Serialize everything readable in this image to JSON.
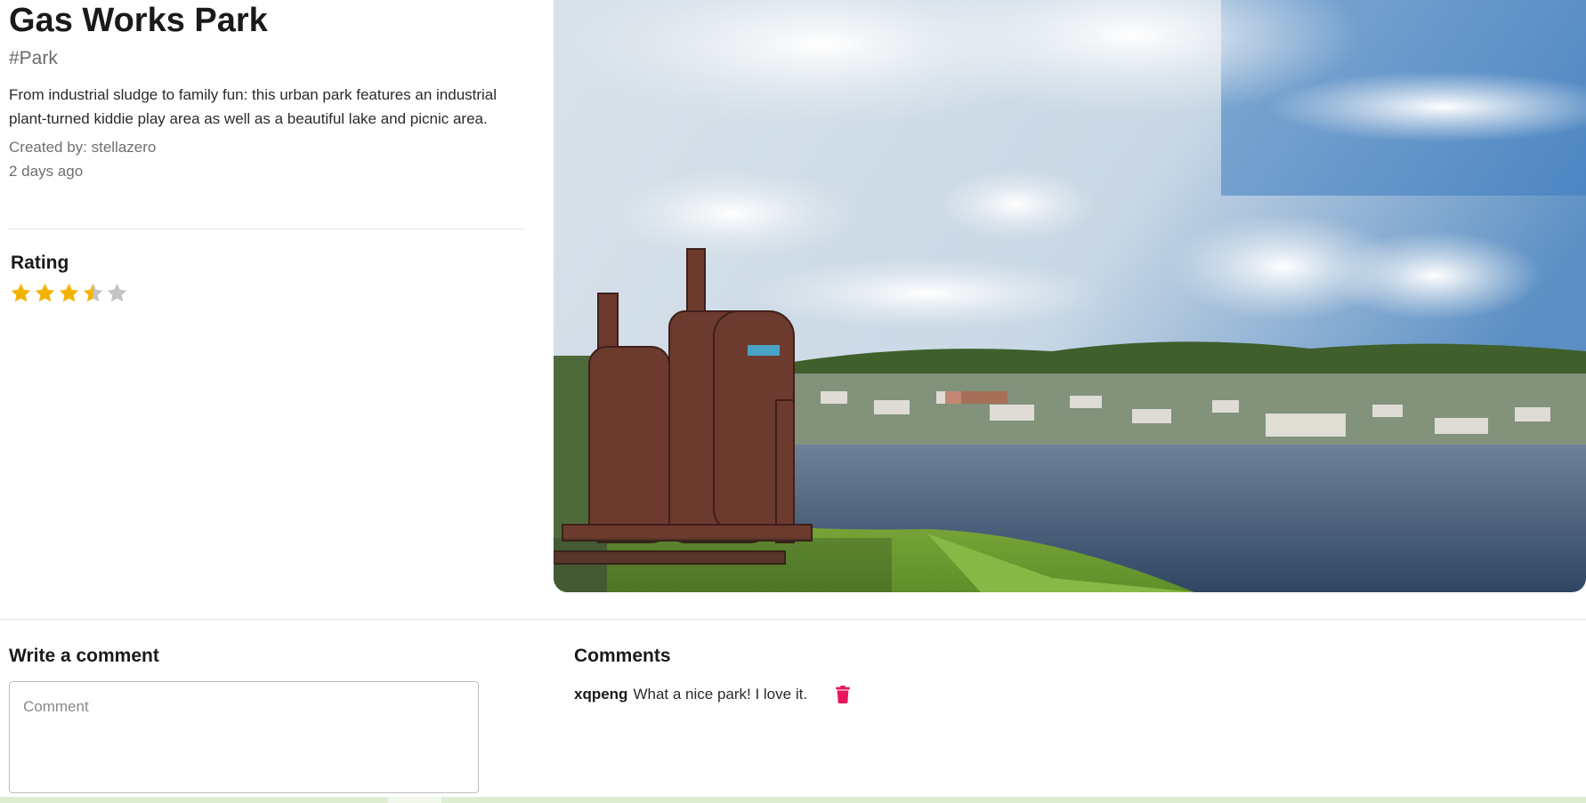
{
  "place": {
    "title": "Gas Works Park",
    "tag": "#Park",
    "description": "From industrial sludge to family fun: this urban park features an industrial plant-turned kiddie play area as well as a beautiful lake and picnic area.",
    "created_by": "Created by: stellazero",
    "time_ago": "2 days ago"
  },
  "rating": {
    "label": "Rating",
    "value": 3.5,
    "max": 5,
    "star_color": "#f5b301",
    "empty_color": "#c4c4c4"
  },
  "photo": {
    "icon": "park-photo"
  },
  "write_comment": {
    "heading": "Write a comment",
    "placeholder": "Comment",
    "value": ""
  },
  "comments": {
    "heading": "Comments",
    "items": [
      {
        "user": "xqpeng",
        "text": "What a nice park! I love it.",
        "delete_icon": "trash-icon",
        "delete_color": "#e8175d"
      }
    ]
  },
  "colors": {
    "accent_bar": "#dfeed3"
  }
}
